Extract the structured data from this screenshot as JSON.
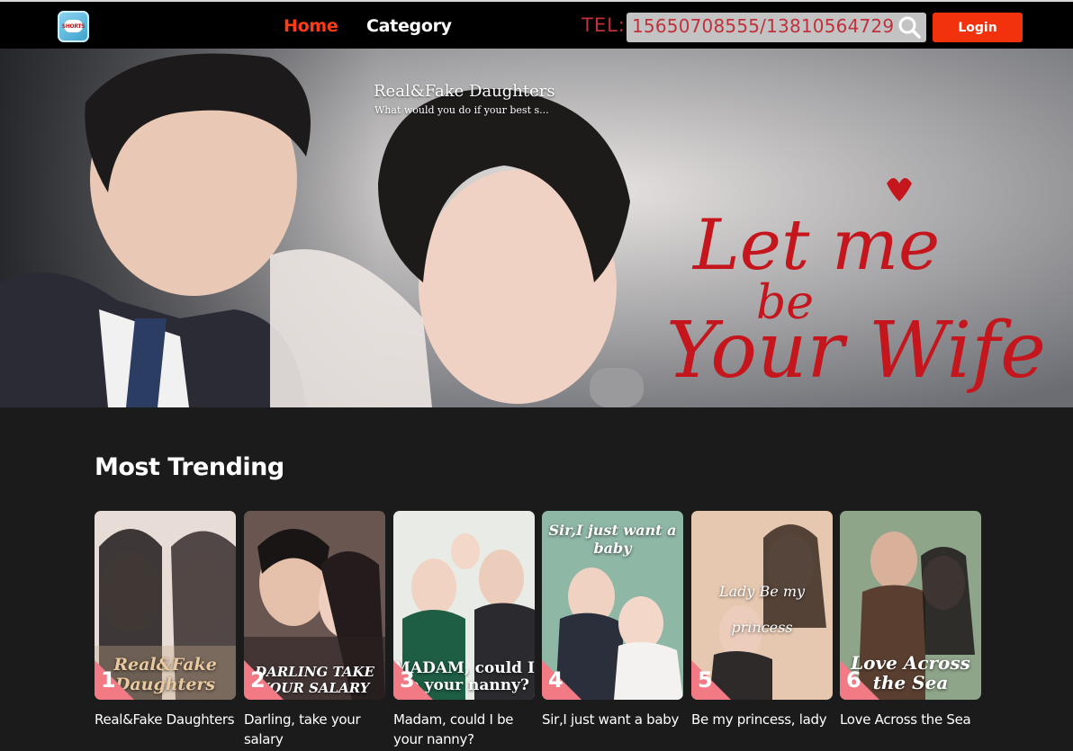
{
  "header": {
    "logo_text": "SHORTS",
    "nav": [
      {
        "label": "Home",
        "active": true
      },
      {
        "label": "Category",
        "active": false
      }
    ],
    "tel_label": "TEL:",
    "search_value": "15650708555/13810564729",
    "login_label": "Login",
    "accent_color": "#f2310d"
  },
  "hero": {
    "title": "Real&Fake Daughters",
    "description": "What would you do if your best s...",
    "artwork_text": [
      "Let me",
      "be",
      "Your Wife"
    ]
  },
  "trending": {
    "heading": "Most Trending",
    "items": [
      {
        "rank": "1",
        "title": "Real&Fake Daughters",
        "poster_text": "Real&Fake Daughters"
      },
      {
        "rank": "2",
        "title": "Darling, take your salary",
        "poster_text": "DARLING TAKE YOUR SALARY"
      },
      {
        "rank": "3",
        "title": "Madam, could I be your nanny?",
        "poster_text": "MADAM, could I be your nanny?"
      },
      {
        "rank": "4",
        "title": "Sir,I just want a baby",
        "poster_text": "Sir,I just want a baby"
      },
      {
        "rank": "5",
        "title": "Be my princess, lady",
        "poster_text": "Lady Be my princess"
      },
      {
        "rank": "6",
        "title": "Love Across the Sea",
        "poster_text": "Love Across the Sea"
      }
    ]
  }
}
